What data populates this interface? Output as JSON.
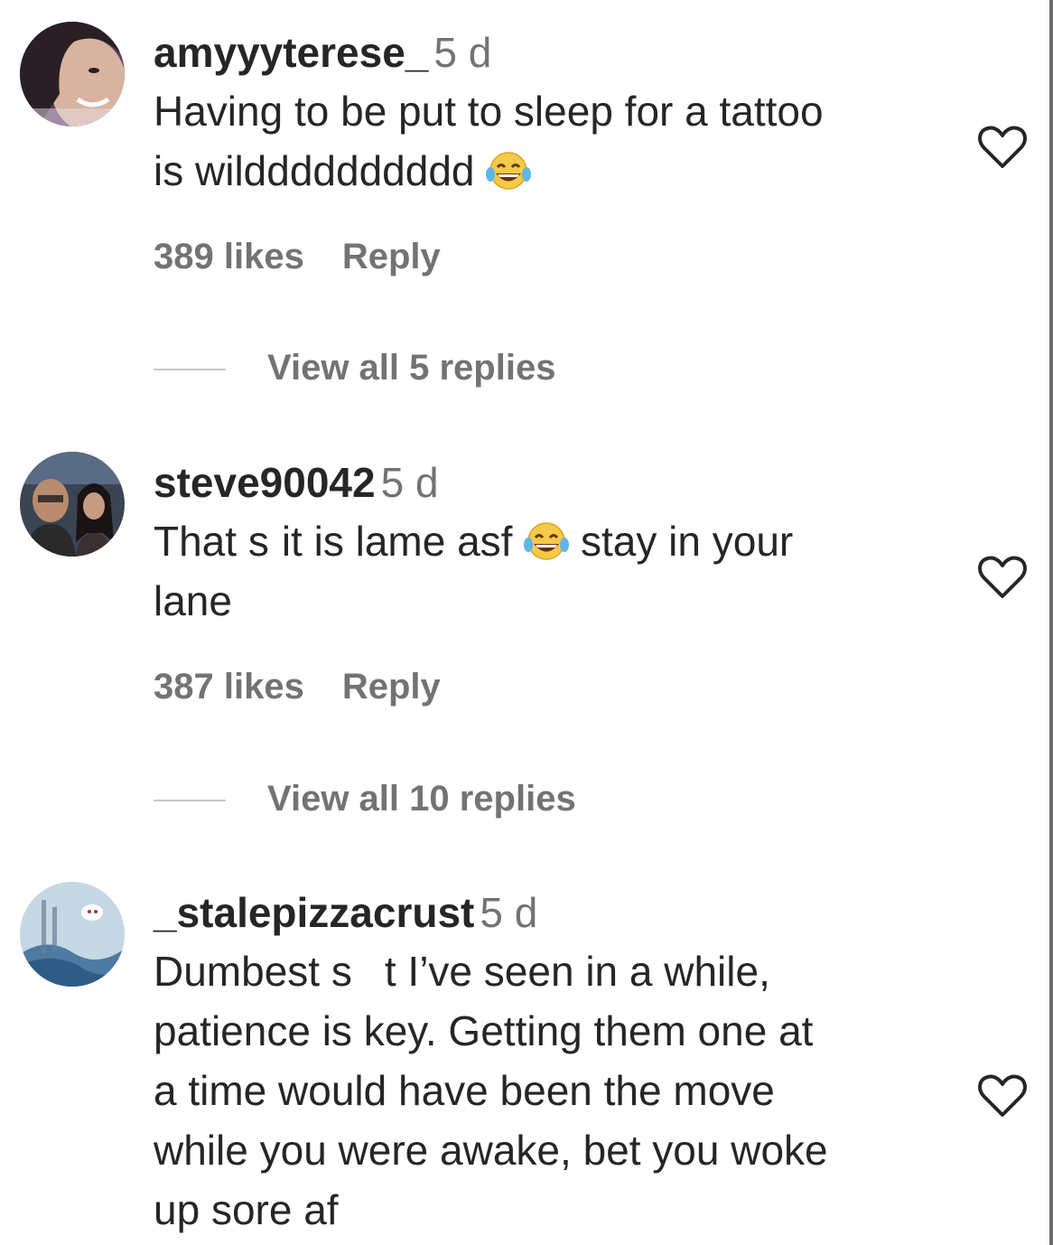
{
  "comments": [
    {
      "username": "amyyyterese_",
      "time": "5 d",
      "text_line1": "Having to be put to sleep for a tattoo",
      "text_line2": "is wildddddddddd",
      "emoji": "laughing-tears-emoji",
      "likes": "389 likes",
      "reply": "Reply",
      "view_replies": "View all 5 replies"
    },
    {
      "username": "steve90042",
      "time": "5 d",
      "text_line1a": "That s",
      "text_line1b": "it is lame asf",
      "text_line1c": "stay in your",
      "text_line2": "lane",
      "emoji": "laughing-tears-emoji",
      "likes": "387 likes",
      "reply": "Reply",
      "view_replies": "View all 10 replies"
    },
    {
      "username": "_stalepizzacrust",
      "time": "5 d",
      "text_line1a": "Dumbest s",
      "text_line1b": "t I’ve seen in a while,",
      "text_line2": "patience is key. Getting them one at",
      "text_line3": "a time would have been the move",
      "text_line4": "while you were awake, bet you woke",
      "text_line5": "up sore af"
    }
  ],
  "icons": {
    "like": "heart-outline-icon"
  },
  "colors": {
    "primary_text": "#262626",
    "secondary_text": "#737373",
    "divider": "#c7c7c7"
  }
}
